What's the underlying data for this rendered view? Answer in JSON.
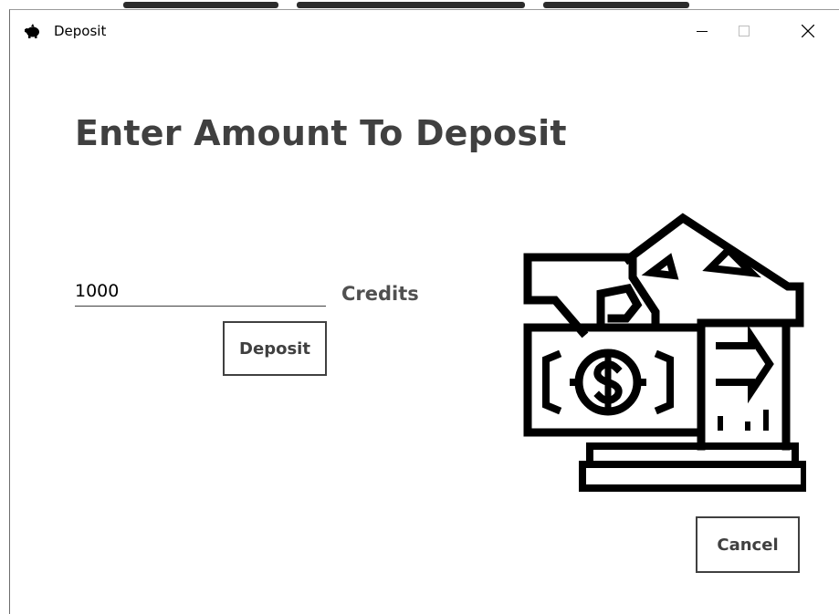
{
  "window": {
    "title": "Deposit",
    "icon": "piggy-bank-icon",
    "controls": {
      "minimize": "minimize-icon",
      "maximize": "maximize-icon",
      "close": "close-icon"
    }
  },
  "form": {
    "heading": "Enter Amount To Deposit",
    "amount_value": "1000",
    "unit_label": "Credits",
    "deposit_label": "Deposit",
    "cancel_label": "Cancel"
  },
  "illustration": {
    "icon": "bank-money-deposit-icon"
  },
  "colors": {
    "text": "#404040",
    "border": "#404040",
    "background": "#ffffff",
    "icon": "#000000"
  }
}
